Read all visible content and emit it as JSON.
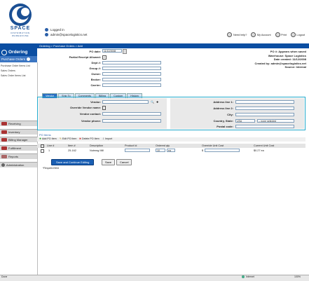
{
  "header": {
    "brand": "SPACE",
    "tagline": "DISTRIBUTION",
    "tagline2": "WAREHOUSE",
    "logged_in_label": "Logged in",
    "user_email": "admin@spacelogistics.net",
    "links": [
      "Need help?",
      "My Account",
      "Print",
      "Logout"
    ]
  },
  "nav": {
    "breadcrumb": "Ordering > Purchase Orders > Add",
    "section": "Ordering",
    "current": "Purchase Orders",
    "side_links": [
      "Purchase Order Items List",
      "Sales Orders",
      "Sales Order Items List"
    ],
    "menu": [
      "Receiving",
      "Inventory",
      "Billing Manager",
      "Fulfillment",
      "Reports",
      "Administration"
    ]
  },
  "form": {
    "po_date_label": "PO date:",
    "po_date_value": "11/12/2008",
    "partial_label": "Partial Receipt Allowed:",
    "dept_label": "Dept #:",
    "group_label": "Group #:",
    "owner_label": "Owner:",
    "broker_label": "Broker:",
    "carrier_label": "Carrier:"
  },
  "info": {
    "line1": "PO #: Appears when saved",
    "line2": "Warehouse: Space Logistics",
    "line3": "Date created: 11/12/2008",
    "line4": "Created by: admin@spacelogistics.net",
    "line5": "Source: Internal"
  },
  "tabs": [
    "Vendor",
    "Ship To",
    "Comments",
    "Billing",
    "Custom",
    "History"
  ],
  "vendor": {
    "vendor_label": "Vendor:",
    "override_label": "Override Vendor name:",
    "contact_label": "Vendor contact:",
    "phone_label": "Vendor phone:",
    "addr1_label": "Address line 1:",
    "addr2_label": "Address line 2:",
    "city_label": "City:",
    "country_state_label": "Country, State:",
    "country_value": "USA",
    "state_value": "-- none selected",
    "postal_label": "Postal code:"
  },
  "items": {
    "section_label": "PO Items",
    "tools": [
      "Add PO Item",
      "Edit PO Item",
      "Delete PO Item",
      "Import"
    ],
    "columns": [
      "Line #",
      "Item #",
      "Description",
      "Product Id",
      "Ordered qty",
      "Override Unit Cost",
      "Current Unit Cost"
    ],
    "row": {
      "line": "1",
      "item": "25-162",
      "description": "Nutmeg Mill",
      "qty": "10",
      "unit": "ea",
      "override_prefix": "$",
      "current_cost": "$0.27 ea"
    }
  },
  "actions": {
    "save_continue": "Save and Continue Editing",
    "save": "Save",
    "cancel": "Cancel",
    "required_note": "*Required field"
  },
  "statusbar": {
    "left": "Done",
    "zone": "Internet",
    "zoom": "100%"
  }
}
